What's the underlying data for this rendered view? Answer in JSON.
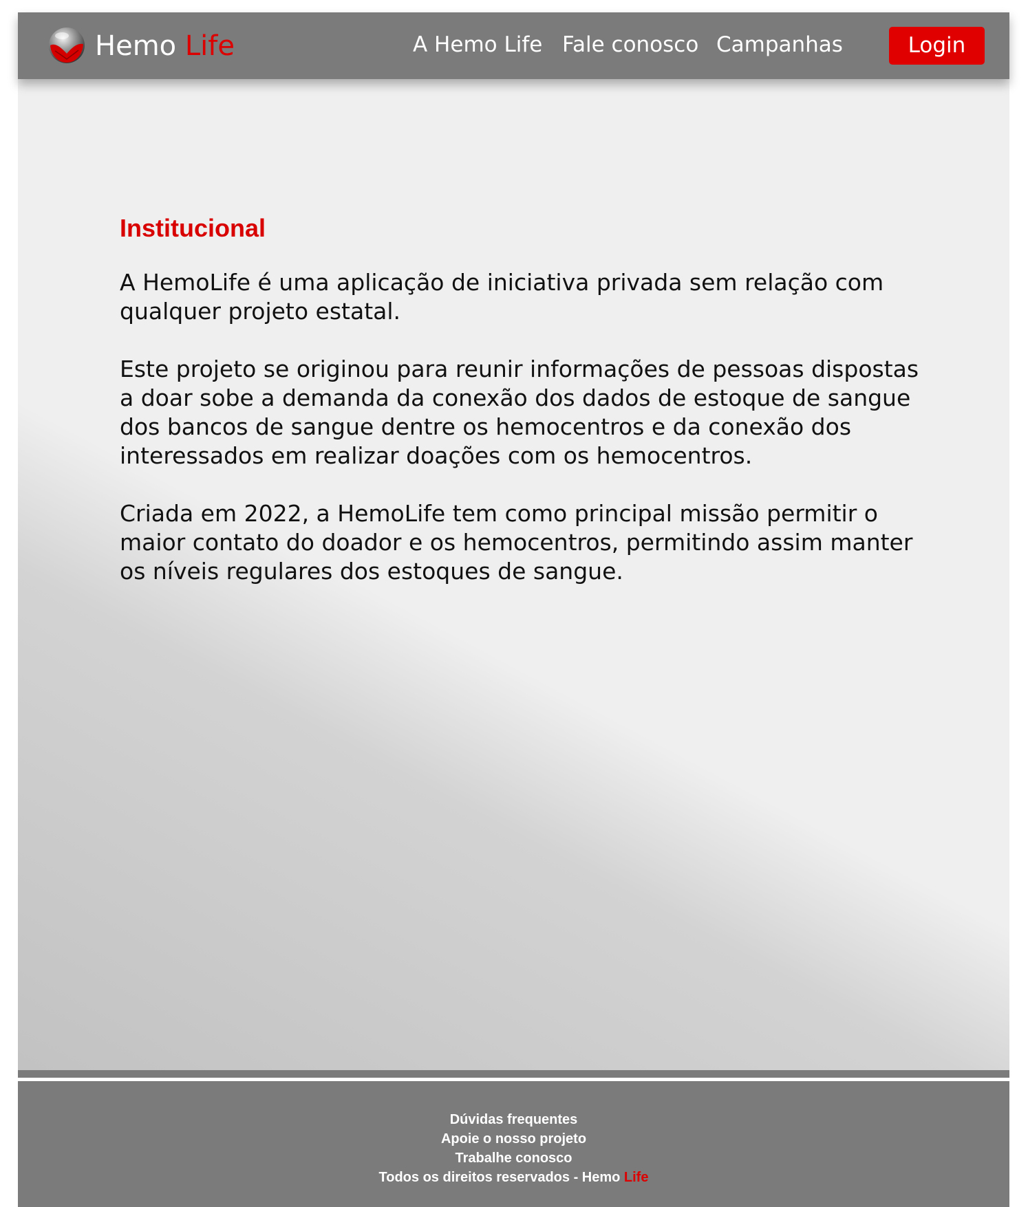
{
  "header": {
    "brand": {
      "name": "Hemo",
      "accent": "Life"
    },
    "nav": [
      {
        "label": "A Hemo Life"
      },
      {
        "label": "Fale conosco"
      },
      {
        "label": "Campanhas"
      }
    ],
    "login_label": "Login"
  },
  "main": {
    "heading": "Institucional",
    "paragraphs": [
      "A HemoLife é uma aplicação de iniciativa privada sem relação com qualquer projeto estatal.",
      "Este projeto se originou para reunir informações de pessoas dispostas a doar sobe a demanda da conexão dos dados de estoque de sangue dos bancos de sangue dentre os hemocentros e da conexão dos interessados em realizar doações com os hemocentros.",
      "Criada em 2022, a HemoLife tem como principal missão permitir o maior contato do doador e os hemocentros, permitindo assim manter os níveis regulares dos estoques de sangue."
    ]
  },
  "footer": {
    "links": [
      {
        "label": "Dúvidas frequentes"
      },
      {
        "label": "Apoie o nosso projeto"
      },
      {
        "label": "Trabalhe conosco"
      }
    ],
    "copyright": {
      "text": "Todos os direitos reservados - Hemo ",
      "accent": "Life"
    }
  },
  "colors": {
    "brand_red": "#dd0000",
    "header_gray": "#7b7b7b",
    "background": "#efefef",
    "text": "#111111"
  },
  "icons": {
    "logo": "blood-drop-sphere-logo-icon"
  }
}
